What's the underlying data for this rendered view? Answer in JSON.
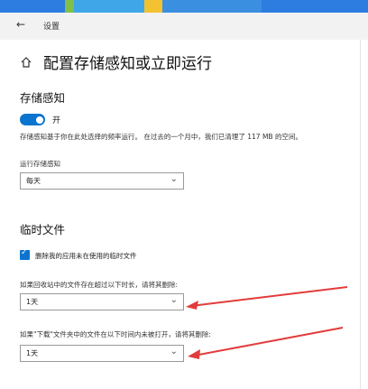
{
  "window": {
    "title": "设置"
  },
  "page": {
    "title": "配置存储感知或立即运行"
  },
  "storage_sense": {
    "heading": "存储感知",
    "toggle_label": "开",
    "description": "存储感知基于你在此处选择的频率运行。 在过去的一个月中，我们已清理了 117 MB 的空间。",
    "run_label": "运行存储感知",
    "run_value": "每天"
  },
  "temp_files": {
    "heading": "临时文件",
    "delete_unused_label": "删除我的应用未在使用的临时文件",
    "delete_unused_checked": true,
    "recycle_label": "如果回收站中的文件存在超过以下时长，请将其删除:",
    "recycle_value": "1天",
    "downloads_label": "如果\"下载\"文件夹中的文件在以下时间内未被打开，请将其删除:",
    "downloads_value": "1天"
  },
  "colors": {
    "accent": "#0a74cf",
    "annotation": "#e23b3b"
  }
}
